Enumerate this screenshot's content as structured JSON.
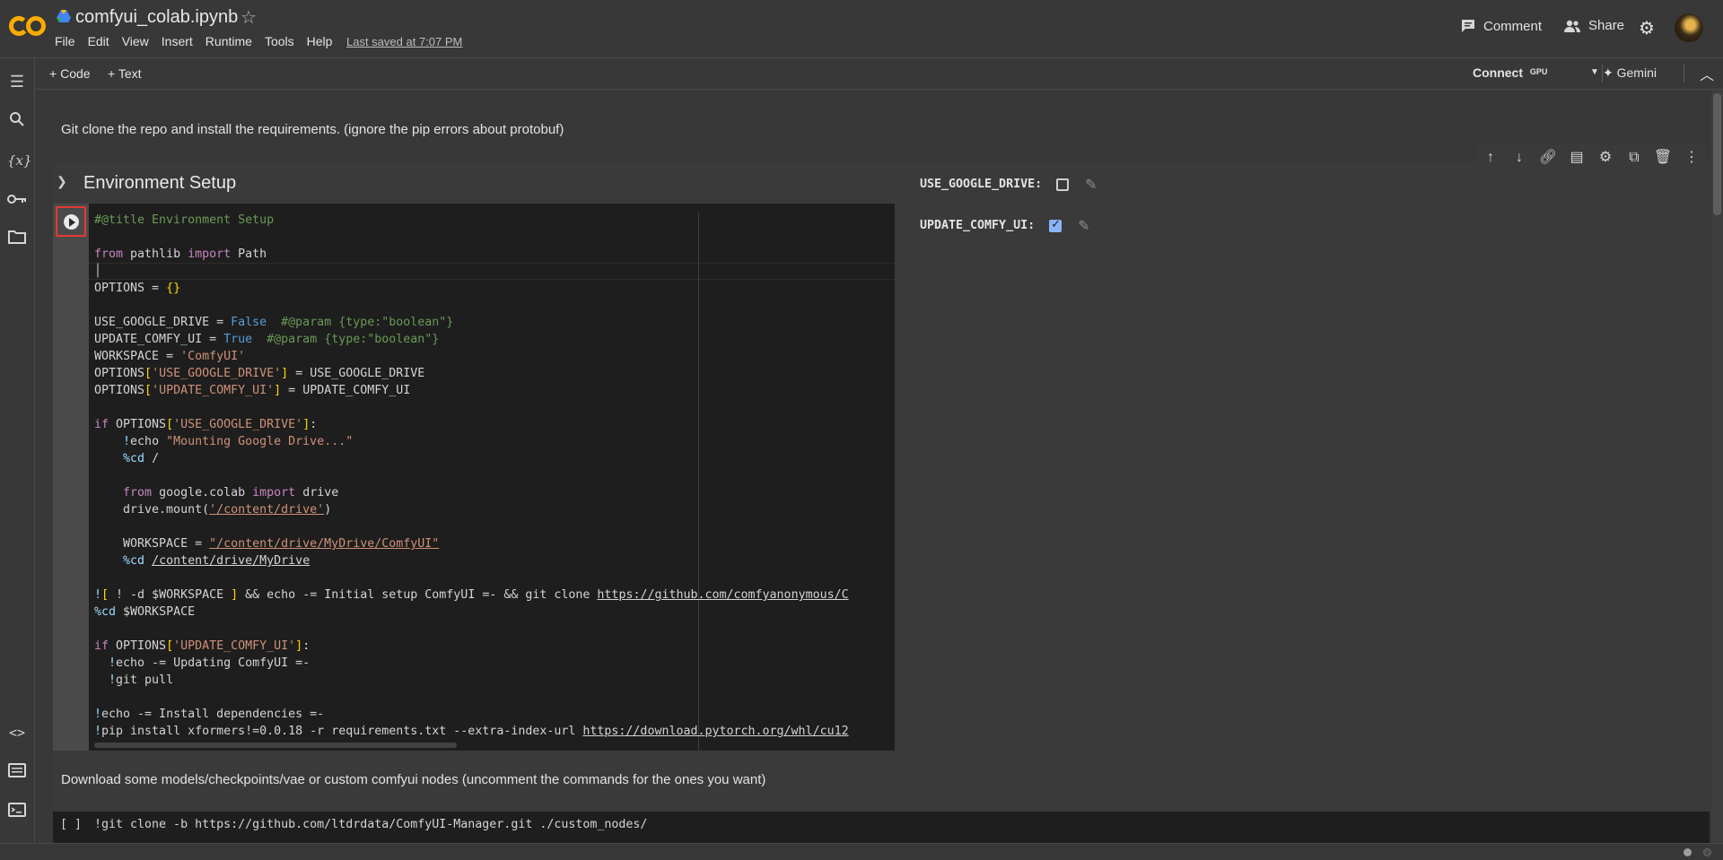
{
  "header": {
    "notebook_title": "comfyui_colab.ipynb",
    "menu": [
      "File",
      "Edit",
      "View",
      "Insert",
      "Runtime",
      "Tools",
      "Help"
    ],
    "last_saved": "Last saved at 7:07 PM",
    "comment_label": "Comment",
    "share_label": "Share"
  },
  "toolbar": {
    "add_code_label": "Code",
    "add_text_label": "Text",
    "connect_label": "Connect",
    "gpu_label": "GPU",
    "gemini_label": "Gemini"
  },
  "cells": {
    "intro_text": "Git clone the repo and install the requirements. (ignore the pip errors about protobuf)",
    "section_title": "Environment Setup",
    "download_text": "Download some models/checkpoints/vae or custom comfyui nodes (uncomment the commands for the ones you want)",
    "next_cell_status": "[ ]",
    "next_cell_code": "!git clone -b https://github.com/ltdrdata/ComfyUI-Manager.git ./custom_nodes/"
  },
  "form": {
    "use_google_drive_label": "USE_GOOGLE_DRIVE:",
    "use_google_drive_checked": false,
    "update_comfy_ui_label": "UPDATE_COMFY_UI:",
    "update_comfy_ui_checked": true
  },
  "icons": {
    "rail": [
      "table-of-contents-icon",
      "search-icon",
      "variables-icon",
      "secrets-key-icon",
      "files-folder-icon",
      "code-snippets-icon",
      "command-palette-icon",
      "terminal-icon"
    ],
    "cell_toolbar": [
      "move-up-icon",
      "move-down-icon",
      "link-icon",
      "comment-icon",
      "settings-icon",
      "mirror-cell-icon",
      "delete-icon",
      "more-icon"
    ]
  },
  "colors": {
    "accent_blue": "#8ab4f8",
    "run_highlight": "#e53935",
    "logo_orange": "#f9ab00"
  }
}
